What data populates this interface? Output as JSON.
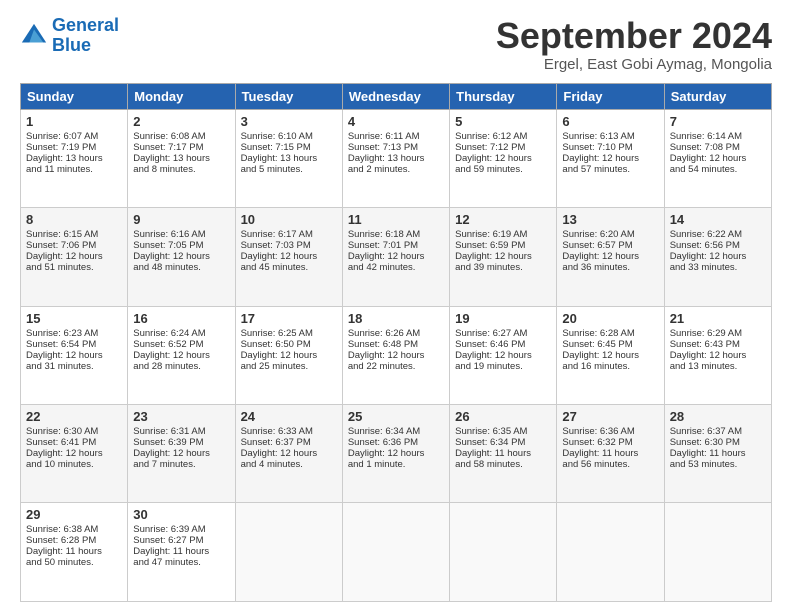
{
  "header": {
    "logo_line1": "General",
    "logo_line2": "Blue",
    "month_title": "September 2024",
    "location": "Ergel, East Gobi Aymag, Mongolia"
  },
  "days_of_week": [
    "Sunday",
    "Monday",
    "Tuesday",
    "Wednesday",
    "Thursday",
    "Friday",
    "Saturday"
  ],
  "weeks": [
    [
      {
        "day": "1",
        "lines": [
          "Sunrise: 6:07 AM",
          "Sunset: 7:19 PM",
          "Daylight: 13 hours",
          "and 11 minutes."
        ]
      },
      {
        "day": "2",
        "lines": [
          "Sunrise: 6:08 AM",
          "Sunset: 7:17 PM",
          "Daylight: 13 hours",
          "and 8 minutes."
        ]
      },
      {
        "day": "3",
        "lines": [
          "Sunrise: 6:10 AM",
          "Sunset: 7:15 PM",
          "Daylight: 13 hours",
          "and 5 minutes."
        ]
      },
      {
        "day": "4",
        "lines": [
          "Sunrise: 6:11 AM",
          "Sunset: 7:13 PM",
          "Daylight: 13 hours",
          "and 2 minutes."
        ]
      },
      {
        "day": "5",
        "lines": [
          "Sunrise: 6:12 AM",
          "Sunset: 7:12 PM",
          "Daylight: 12 hours",
          "and 59 minutes."
        ]
      },
      {
        "day": "6",
        "lines": [
          "Sunrise: 6:13 AM",
          "Sunset: 7:10 PM",
          "Daylight: 12 hours",
          "and 57 minutes."
        ]
      },
      {
        "day": "7",
        "lines": [
          "Sunrise: 6:14 AM",
          "Sunset: 7:08 PM",
          "Daylight: 12 hours",
          "and 54 minutes."
        ]
      }
    ],
    [
      {
        "day": "8",
        "lines": [
          "Sunrise: 6:15 AM",
          "Sunset: 7:06 PM",
          "Daylight: 12 hours",
          "and 51 minutes."
        ]
      },
      {
        "day": "9",
        "lines": [
          "Sunrise: 6:16 AM",
          "Sunset: 7:05 PM",
          "Daylight: 12 hours",
          "and 48 minutes."
        ]
      },
      {
        "day": "10",
        "lines": [
          "Sunrise: 6:17 AM",
          "Sunset: 7:03 PM",
          "Daylight: 12 hours",
          "and 45 minutes."
        ]
      },
      {
        "day": "11",
        "lines": [
          "Sunrise: 6:18 AM",
          "Sunset: 7:01 PM",
          "Daylight: 12 hours",
          "and 42 minutes."
        ]
      },
      {
        "day": "12",
        "lines": [
          "Sunrise: 6:19 AM",
          "Sunset: 6:59 PM",
          "Daylight: 12 hours",
          "and 39 minutes."
        ]
      },
      {
        "day": "13",
        "lines": [
          "Sunrise: 6:20 AM",
          "Sunset: 6:57 PM",
          "Daylight: 12 hours",
          "and 36 minutes."
        ]
      },
      {
        "day": "14",
        "lines": [
          "Sunrise: 6:22 AM",
          "Sunset: 6:56 PM",
          "Daylight: 12 hours",
          "and 33 minutes."
        ]
      }
    ],
    [
      {
        "day": "15",
        "lines": [
          "Sunrise: 6:23 AM",
          "Sunset: 6:54 PM",
          "Daylight: 12 hours",
          "and 31 minutes."
        ]
      },
      {
        "day": "16",
        "lines": [
          "Sunrise: 6:24 AM",
          "Sunset: 6:52 PM",
          "Daylight: 12 hours",
          "and 28 minutes."
        ]
      },
      {
        "day": "17",
        "lines": [
          "Sunrise: 6:25 AM",
          "Sunset: 6:50 PM",
          "Daylight: 12 hours",
          "and 25 minutes."
        ]
      },
      {
        "day": "18",
        "lines": [
          "Sunrise: 6:26 AM",
          "Sunset: 6:48 PM",
          "Daylight: 12 hours",
          "and 22 minutes."
        ]
      },
      {
        "day": "19",
        "lines": [
          "Sunrise: 6:27 AM",
          "Sunset: 6:46 PM",
          "Daylight: 12 hours",
          "and 19 minutes."
        ]
      },
      {
        "day": "20",
        "lines": [
          "Sunrise: 6:28 AM",
          "Sunset: 6:45 PM",
          "Daylight: 12 hours",
          "and 16 minutes."
        ]
      },
      {
        "day": "21",
        "lines": [
          "Sunrise: 6:29 AM",
          "Sunset: 6:43 PM",
          "Daylight: 12 hours",
          "and 13 minutes."
        ]
      }
    ],
    [
      {
        "day": "22",
        "lines": [
          "Sunrise: 6:30 AM",
          "Sunset: 6:41 PM",
          "Daylight: 12 hours",
          "and 10 minutes."
        ]
      },
      {
        "day": "23",
        "lines": [
          "Sunrise: 6:31 AM",
          "Sunset: 6:39 PM",
          "Daylight: 12 hours",
          "and 7 minutes."
        ]
      },
      {
        "day": "24",
        "lines": [
          "Sunrise: 6:33 AM",
          "Sunset: 6:37 PM",
          "Daylight: 12 hours",
          "and 4 minutes."
        ]
      },
      {
        "day": "25",
        "lines": [
          "Sunrise: 6:34 AM",
          "Sunset: 6:36 PM",
          "Daylight: 12 hours",
          "and 1 minute."
        ]
      },
      {
        "day": "26",
        "lines": [
          "Sunrise: 6:35 AM",
          "Sunset: 6:34 PM",
          "Daylight: 11 hours",
          "and 58 minutes."
        ]
      },
      {
        "day": "27",
        "lines": [
          "Sunrise: 6:36 AM",
          "Sunset: 6:32 PM",
          "Daylight: 11 hours",
          "and 56 minutes."
        ]
      },
      {
        "day": "28",
        "lines": [
          "Sunrise: 6:37 AM",
          "Sunset: 6:30 PM",
          "Daylight: 11 hours",
          "and 53 minutes."
        ]
      }
    ],
    [
      {
        "day": "29",
        "lines": [
          "Sunrise: 6:38 AM",
          "Sunset: 6:28 PM",
          "Daylight: 11 hours",
          "and 50 minutes."
        ]
      },
      {
        "day": "30",
        "lines": [
          "Sunrise: 6:39 AM",
          "Sunset: 6:27 PM",
          "Daylight: 11 hours",
          "and 47 minutes."
        ]
      },
      {
        "day": "",
        "lines": []
      },
      {
        "day": "",
        "lines": []
      },
      {
        "day": "",
        "lines": []
      },
      {
        "day": "",
        "lines": []
      },
      {
        "day": "",
        "lines": []
      }
    ]
  ]
}
